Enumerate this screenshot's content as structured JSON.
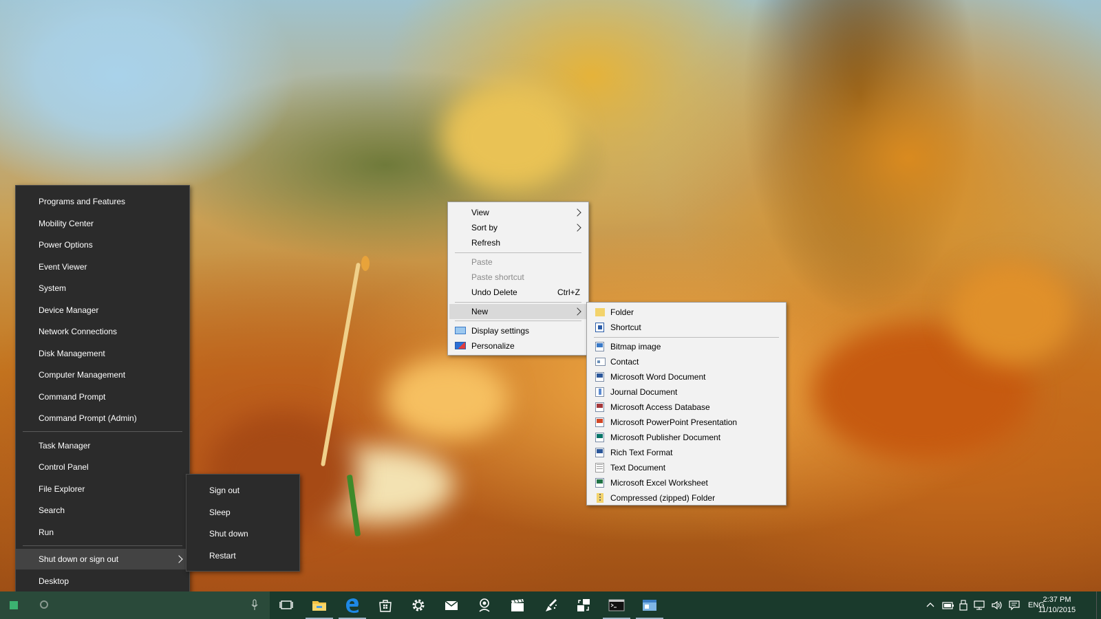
{
  "winx_menu": {
    "items": [
      {
        "label": "Programs and Features"
      },
      {
        "label": "Mobility Center"
      },
      {
        "label": "Power Options"
      },
      {
        "label": "Event Viewer"
      },
      {
        "label": "System"
      },
      {
        "label": "Device Manager"
      },
      {
        "label": "Network Connections"
      },
      {
        "label": "Disk Management"
      },
      {
        "label": "Computer Management"
      },
      {
        "label": "Command Prompt"
      },
      {
        "label": "Command Prompt (Admin)"
      }
    ],
    "items2": [
      {
        "label": "Task Manager"
      },
      {
        "label": "Control Panel"
      },
      {
        "label": "File Explorer"
      },
      {
        "label": "Search"
      },
      {
        "label": "Run"
      }
    ],
    "shutdown": {
      "label": "Shut down or sign out"
    },
    "desktop": {
      "label": "Desktop"
    }
  },
  "power_submenu": {
    "items": [
      {
        "label": "Sign out"
      },
      {
        "label": "Sleep"
      },
      {
        "label": "Shut down"
      },
      {
        "label": "Restart"
      }
    ]
  },
  "desktop_context_menu": {
    "view": "View",
    "sort_by": "Sort by",
    "refresh": "Refresh",
    "paste": "Paste",
    "paste_shortcut": "Paste shortcut",
    "undo_delete": "Undo Delete",
    "undo_shortcut": "Ctrl+Z",
    "new": "New",
    "display_settings": "Display settings",
    "personalize": "Personalize"
  },
  "new_submenu": {
    "folder": "Folder",
    "shortcut": "Shortcut",
    "items": [
      {
        "label": "Bitmap image",
        "icon": "bitmap-icon"
      },
      {
        "label": "Contact",
        "icon": "contact-icon"
      },
      {
        "label": "Microsoft Word Document",
        "icon": "word-icon"
      },
      {
        "label": "Journal Document",
        "icon": "journal-icon"
      },
      {
        "label": "Microsoft Access Database",
        "icon": "access-icon"
      },
      {
        "label": "Microsoft PowerPoint Presentation",
        "icon": "powerpoint-icon"
      },
      {
        "label": "Microsoft Publisher Document",
        "icon": "publisher-icon"
      },
      {
        "label": "Rich Text Format",
        "icon": "rtf-icon"
      },
      {
        "label": "Text Document",
        "icon": "text-document-icon"
      },
      {
        "label": "Microsoft Excel Worksheet",
        "icon": "excel-icon"
      },
      {
        "label": "Compressed (zipped) Folder",
        "icon": "zip-folder-icon"
      }
    ]
  },
  "taskbar": {
    "language": "ENG",
    "time": "2:37 PM",
    "date": "11/10/2015"
  },
  "colors": {
    "menu_dark": "#2b2b2b",
    "menu_light": "#f2f2f2",
    "taskbar": "#1a3a2c",
    "edge_blue": "#1e88e5"
  }
}
